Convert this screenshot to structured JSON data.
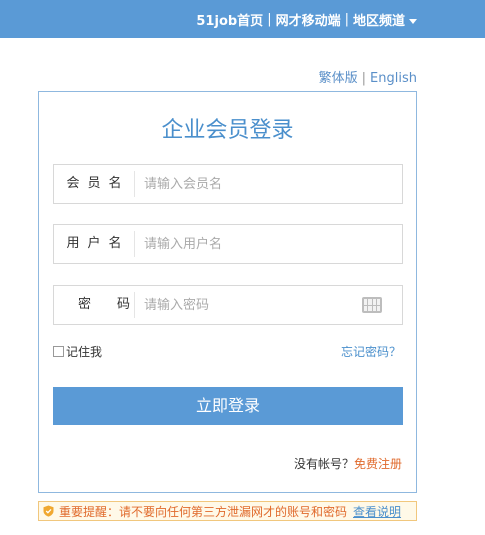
{
  "topnav": {
    "home": "51job首页",
    "mobile": "网才移动端",
    "region": "地区频道",
    "separator": "|"
  },
  "lang": {
    "traditional": "繁体版",
    "english": "English",
    "separator": "|"
  },
  "login": {
    "title": "企业会员登录",
    "member_label": "会员名",
    "member_placeholder": "请输入会员名",
    "user_label": "用户名",
    "user_placeholder": "请输入用户名",
    "password_label": "密码",
    "password_placeholder": "请输入密码",
    "remember": "记住我",
    "forgot": "忘记密码？",
    "submit": "立即登录",
    "no_account": "没有帐号？",
    "register": "免费注册"
  },
  "notice": {
    "text": "重要提醒：请不要向任何第三方泄漏网才的账号和密码",
    "link": "查看说明"
  },
  "colors": {
    "brand": "#5a9ad6",
    "link": "#4a8fcc",
    "warning": "#e06a2c"
  }
}
